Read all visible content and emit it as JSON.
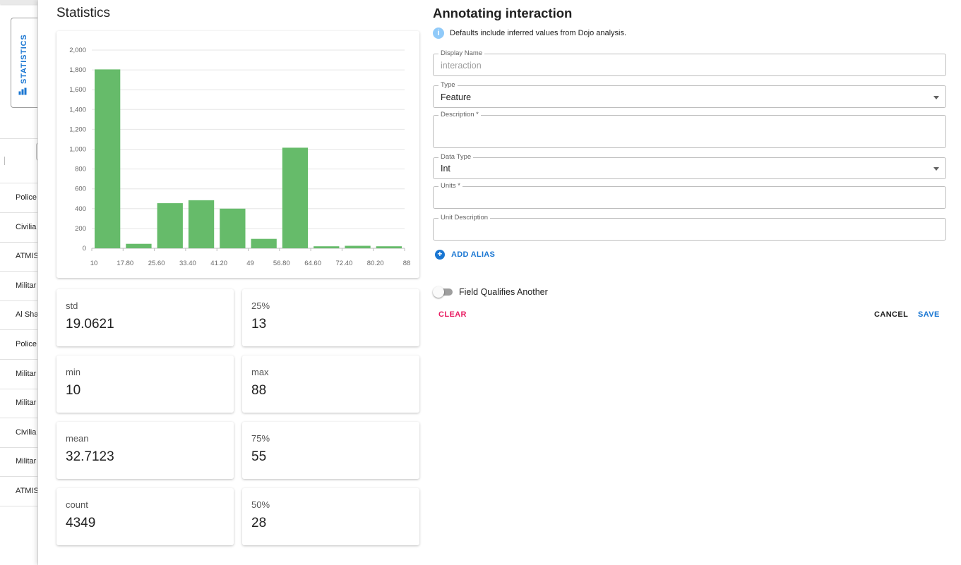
{
  "background": {
    "stats_tab_label": "STATISTICS",
    "rows": [
      "Police",
      "Civilia",
      "ATMIS",
      "Militar",
      "Al Sha",
      "Police",
      "Militar",
      "Militar",
      "Civilia",
      "Militar",
      "ATMIS"
    ]
  },
  "statistics": {
    "title": "Statistics",
    "cards": {
      "std": {
        "label": "std",
        "value": "19.0621"
      },
      "p25": {
        "label": "25%",
        "value": "13"
      },
      "min": {
        "label": "min",
        "value": "10"
      },
      "max": {
        "label": "max",
        "value": "88"
      },
      "mean": {
        "label": "mean",
        "value": "32.7123"
      },
      "p75": {
        "label": "75%",
        "value": "55"
      },
      "count": {
        "label": "count",
        "value": "4349"
      },
      "p50": {
        "label": "50%",
        "value": "28"
      }
    }
  },
  "chart_data": {
    "type": "bar",
    "categories": [
      "10",
      "17.80",
      "25.60",
      "33.40",
      "41.20",
      "49",
      "56.80",
      "64.60",
      "72.40",
      "80.20"
    ],
    "x_ticks": [
      "10",
      "17.80",
      "25.60",
      "33.40",
      "41.20",
      "49",
      "56.80",
      "64.60",
      "72.40",
      "80.20",
      "88"
    ],
    "values": [
      1805,
      45,
      455,
      485,
      400,
      95,
      1015,
      20,
      25,
      20
    ],
    "y_ticks": [
      "0",
      "200",
      "400",
      "600",
      "800",
      "1,000",
      "1,200",
      "1,400",
      "1,600",
      "1,800",
      "2,000"
    ],
    "ylim": [
      0,
      2000
    ],
    "bar_color": "#66bb6a",
    "grid": true,
    "title": "",
    "xlabel": "",
    "ylabel": ""
  },
  "form": {
    "title_prefix": "Annotating ",
    "title_name": "interaction",
    "info_text": "Defaults include inferred values from Dojo analysis.",
    "display_name": {
      "label": "Display Name",
      "value": "interaction"
    },
    "type": {
      "label": "Type",
      "value": "Feature"
    },
    "description": {
      "label": "Description *",
      "value": ""
    },
    "data_type": {
      "label": "Data Type",
      "value": "Int"
    },
    "units": {
      "label": "Units *",
      "value": ""
    },
    "unit_description": {
      "label": "Unit Description",
      "value": ""
    },
    "add_alias": "ADD ALIAS",
    "qualifies_toggle": {
      "label": "Field Qualifies Another",
      "on": false
    },
    "clear_label": "CLEAR",
    "cancel_label": "CANCEL",
    "save_label": "SAVE"
  },
  "colors": {
    "accent": "#1976d2",
    "danger": "#e91e63",
    "bar": "#66bb6a",
    "info": "#90caf9"
  },
  "icons": {
    "stats_tab": "bar-chart-icon",
    "info": "info-icon",
    "add_alias": "plus-circle-icon"
  }
}
